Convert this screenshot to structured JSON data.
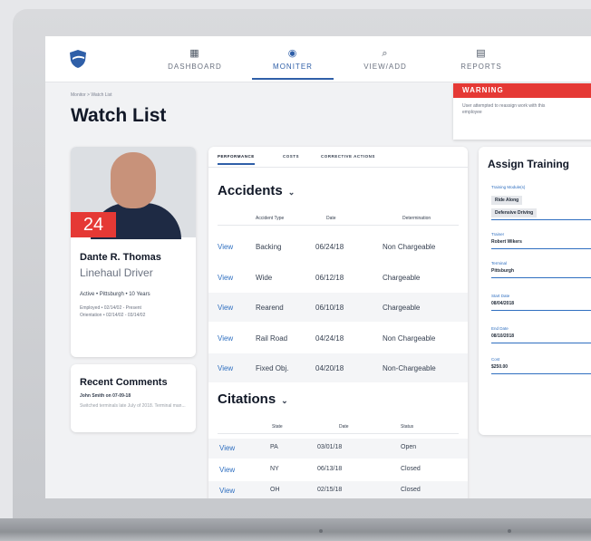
{
  "nav": {
    "items": [
      {
        "label": "DASHBOARD",
        "icon": "grid-icon"
      },
      {
        "label": "MONITER",
        "icon": "eye-icon"
      },
      {
        "label": "VIEW/ADD",
        "icon": "search-icon"
      },
      {
        "label": "REPORTS",
        "icon": "report-icon"
      }
    ],
    "active_index": 1
  },
  "breadcrumb": "Monitor > Watch List",
  "page_title": "Watch List",
  "warning": {
    "header": "WARNING",
    "text": "User attempted to reassign work with this employee"
  },
  "profile": {
    "badge": "24",
    "name": "Dante R. Thomas",
    "role": "Linehaul Driver",
    "info": "Active • Pittsburgh • 10 Years",
    "employed": "Employed • 02/14/02 - Present",
    "orientation": "Orientation • 02/14/02 - 03/14/02"
  },
  "comments": {
    "title": "Recent Comments",
    "author": "John Smith on 07-09-18",
    "text": "Switched terminals late July of 2018. Terminal man..."
  },
  "tabs": [
    "PERFORMANCE",
    "COSTS",
    "CORRECTIVE ACTIONS"
  ],
  "accidents": {
    "title": "Accidents",
    "headers": [
      "Accident Type",
      "Date",
      "Determination"
    ],
    "rows": [
      {
        "link": "View",
        "type": "Backing",
        "date": "06/24/18",
        "det": "Non Chargeable"
      },
      {
        "link": "View",
        "type": "Wide",
        "date": "06/12/18",
        "det": "Chargeable"
      },
      {
        "link": "View",
        "type": "Rearend",
        "date": "06/10/18",
        "det": "Chargeable"
      },
      {
        "link": "View",
        "type": "Rail Road",
        "date": "04/24/18",
        "det": "Non Chargeable"
      },
      {
        "link": "View",
        "type": "Fixed Obj.",
        "date": "04/20/18",
        "det": "Non-Chargeable"
      }
    ]
  },
  "citations": {
    "title": "Citations",
    "headers": [
      "State",
      "Date",
      "Status"
    ],
    "rows": [
      {
        "link": "View",
        "state": "PA",
        "date": "03/01/18",
        "status": "Open"
      },
      {
        "link": "View",
        "state": "NY",
        "date": "06/13/18",
        "status": "Closed"
      },
      {
        "link": "View",
        "state": "OH",
        "date": "02/15/18",
        "status": "Closed"
      }
    ]
  },
  "training": {
    "title": "Assign Training",
    "module_label": "Training Module(s)",
    "modules": [
      "Ride Along",
      "Defensive Driving"
    ],
    "trainer_label": "Trainer",
    "trainer": "Robert Wikers",
    "terminal_label": "Terminal",
    "terminal": "Pittsburgh",
    "start_label": "Start Date",
    "start": "08/04/2018",
    "end_label": "End Date",
    "end": "08/10/2018",
    "cost_label": "Cost",
    "cost": "$250.00"
  },
  "colors": {
    "accent": "#2f5fa8",
    "warning": "#e53935",
    "link": "#2f6fc0"
  }
}
